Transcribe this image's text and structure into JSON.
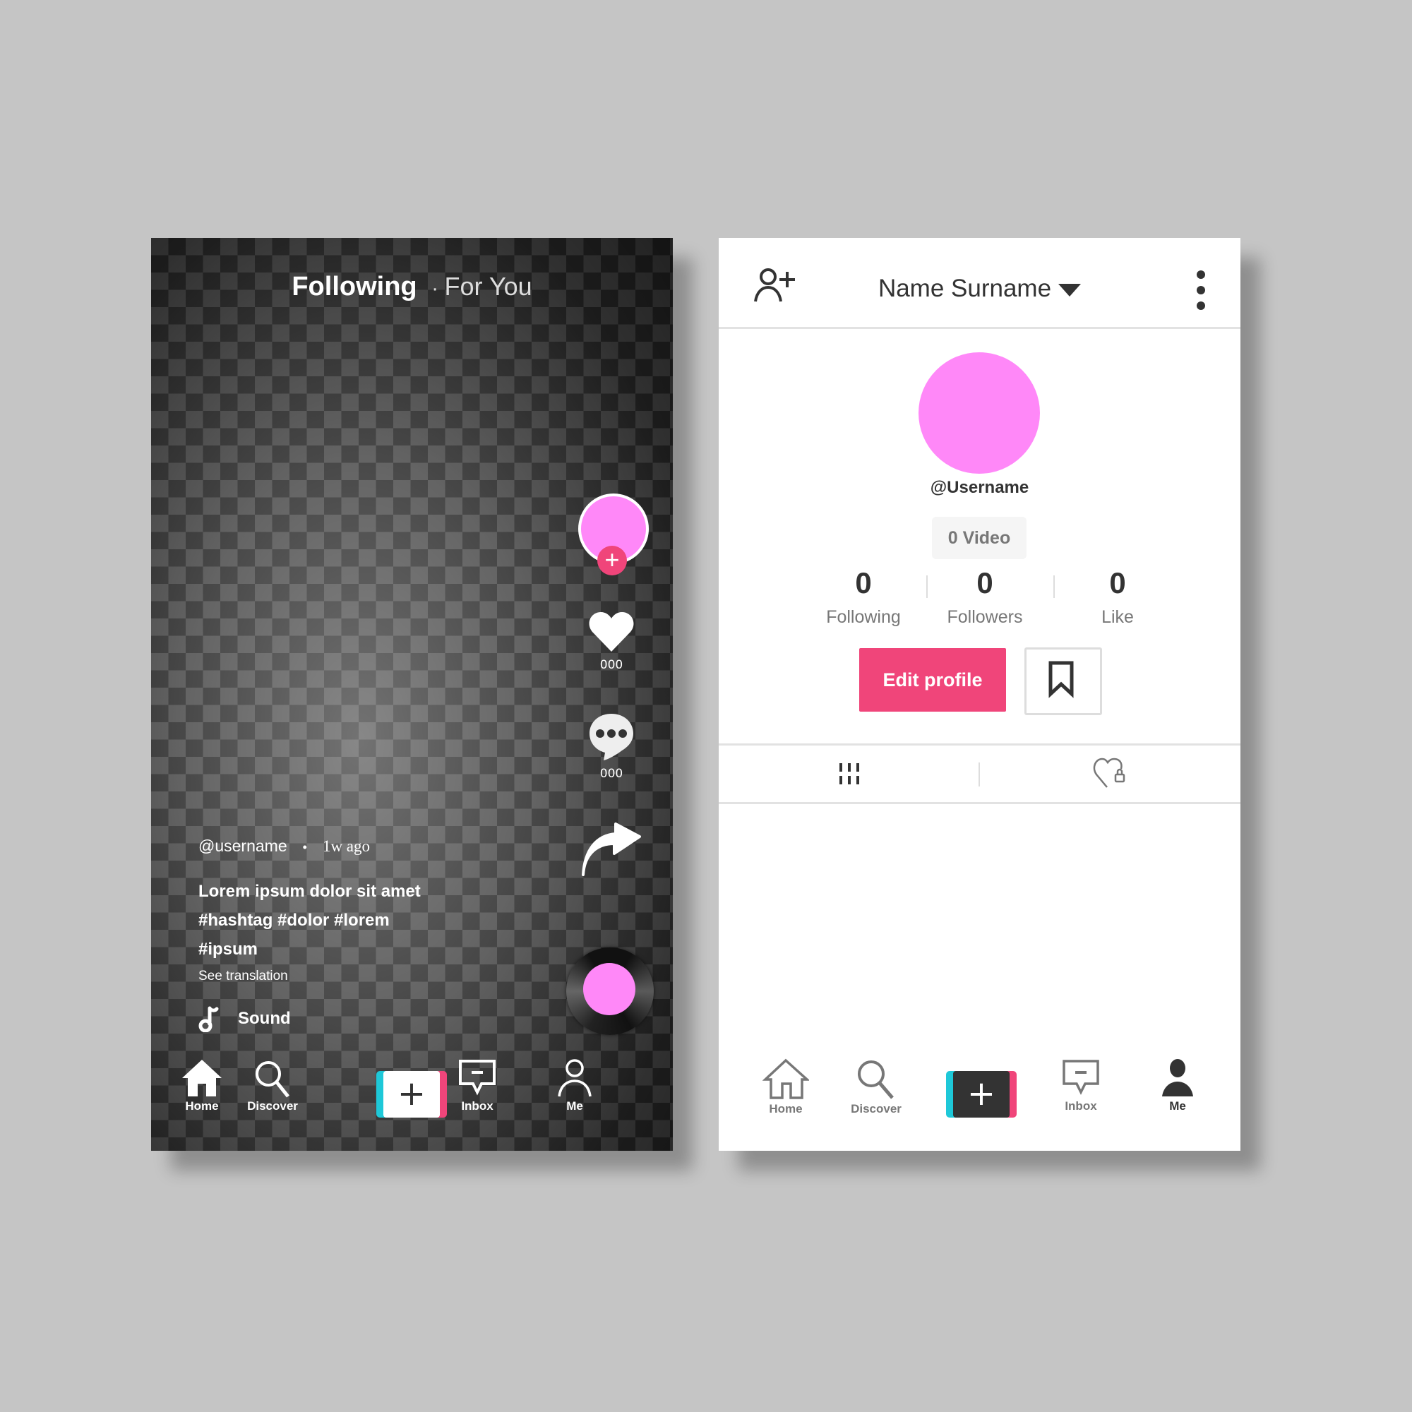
{
  "feed": {
    "tabs": {
      "following": "Following",
      "separator": "·",
      "for_you": "For You"
    },
    "actions": {
      "follow_plus": "+",
      "likes_count": "000",
      "comments_count": "000"
    },
    "post": {
      "username": "@username",
      "dot": "•",
      "time_ago": "1w ago",
      "description_lines": [
        "Lorem ipsum dolor sit amet",
        "#hashtag #dolor #lorem",
        "#ipsum"
      ],
      "see_translation": "See translation",
      "sound": "Sound"
    },
    "nav": {
      "home": "Home",
      "discover": "Discover",
      "create": "+",
      "inbox": "Inbox",
      "me": "Me"
    }
  },
  "profile": {
    "header": {
      "title": "Name Surname"
    },
    "username": "@Username",
    "video_count": "0 Video",
    "stats": [
      {
        "value": "0",
        "label": "Following"
      },
      {
        "value": "0",
        "label": "Followers"
      },
      {
        "value": "0",
        "label": "Like"
      }
    ],
    "edit_profile": "Edit profile",
    "nav": {
      "home": "Home",
      "discover": "Discover",
      "create": "+",
      "inbox": "Inbox",
      "me": "Me",
      "active": "me"
    }
  },
  "colors": {
    "accent": "#f0457a",
    "cyan": "#1ec8d8",
    "avatar": "#ff88f8",
    "background": "#c5c5c5"
  }
}
